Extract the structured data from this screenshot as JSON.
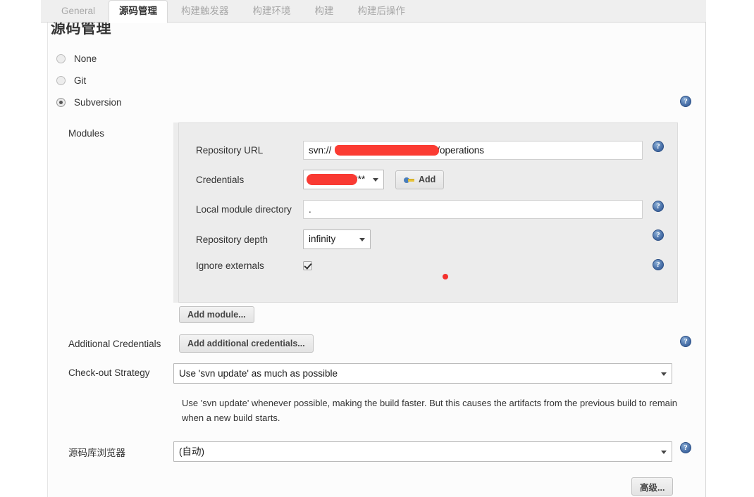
{
  "page": {
    "heading": "源码管理"
  },
  "tabs": [
    {
      "label": "General",
      "active": false
    },
    {
      "label": "源码管理",
      "active": true
    },
    {
      "label": "构建触发器",
      "active": false
    },
    {
      "label": "构建环境",
      "active": false
    },
    {
      "label": "构建",
      "active": false
    },
    {
      "label": "构建后操作",
      "active": false
    }
  ],
  "scm_options": [
    {
      "label": "None",
      "selected": false
    },
    {
      "label": "Git",
      "selected": false
    },
    {
      "label": "Subversion",
      "selected": true
    }
  ],
  "modules": {
    "section_label": "Modules",
    "repository_url": {
      "label": "Repository URL",
      "value_prefix": "svn://",
      "value_suffix": "/operations",
      "redacted": true
    },
    "credentials": {
      "label": "Credentials",
      "value_suffix": "*****",
      "redacted": true,
      "add_button": "Add"
    },
    "local_module_directory": {
      "label": "Local module directory",
      "value": "."
    },
    "repository_depth": {
      "label": "Repository depth",
      "value": "infinity"
    },
    "ignore_externals": {
      "label": "Ignore externals",
      "checked": true
    },
    "add_module_button": "Add module..."
  },
  "additional_credentials": {
    "label": "Additional Credentials",
    "button": "Add additional credentials..."
  },
  "checkout_strategy": {
    "label": "Check-out Strategy",
    "value": "Use 'svn update' as much as possible",
    "description": "Use 'svn update' whenever possible, making the build faster. But this causes the artifacts from the previous build to remain when a new build starts."
  },
  "repository_browser": {
    "label": "源码库浏览器",
    "value": "(自动)"
  },
  "advanced_button": "高级...",
  "icons": {
    "help": "?"
  },
  "colors": {
    "redaction": "#f93a33",
    "annotation_dot": "#f4302c",
    "help_icon": "#4d74ab"
  }
}
